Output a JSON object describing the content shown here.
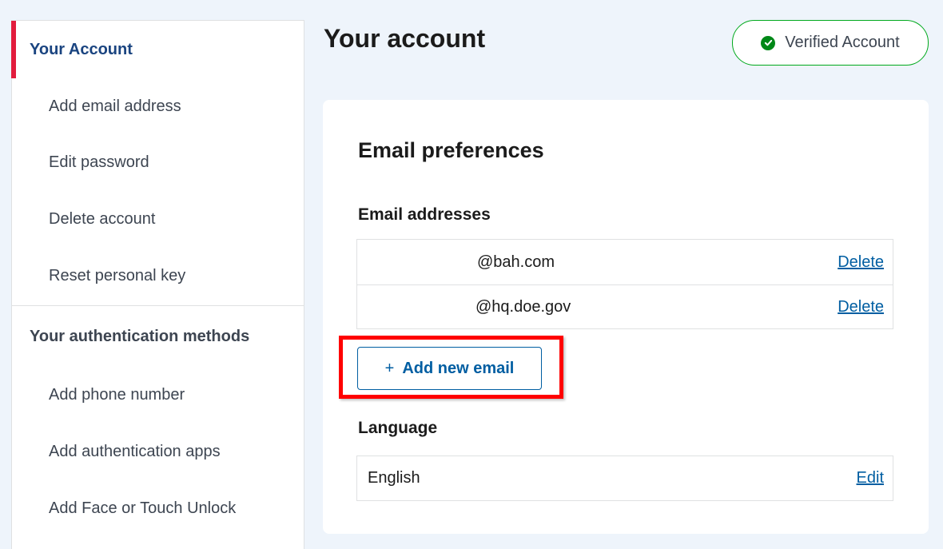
{
  "sidebar": {
    "active_label": "Your Account",
    "account_items": [
      {
        "label": "Add email address"
      },
      {
        "label": "Edit password"
      },
      {
        "label": "Delete account"
      },
      {
        "label": "Reset personal key"
      }
    ],
    "auth_heading": "Your authentication methods",
    "auth_items": [
      {
        "label": "Add phone number"
      },
      {
        "label": "Add authentication apps"
      },
      {
        "label": "Add Face or Touch Unlock"
      }
    ]
  },
  "header": {
    "title": "Your account",
    "verified_label": "Verified Account"
  },
  "card": {
    "title": "Email preferences",
    "emails_heading": "Email addresses",
    "emails": [
      {
        "address": "@bah.com",
        "action": "Delete"
      },
      {
        "address": "@hq.doe.gov",
        "action": "Delete"
      }
    ],
    "add_email_icon": "+",
    "add_email_label": "Add new email",
    "language_heading": "Language",
    "language_value": "English",
    "language_action": "Edit"
  },
  "colors": {
    "accent_red": "#e21c3d",
    "link_blue": "#005ea2",
    "verified_green": "#008817",
    "highlight_red": "#ff0000"
  },
  "icons": {
    "verified": "check-circle-icon",
    "add": "plus-icon"
  }
}
